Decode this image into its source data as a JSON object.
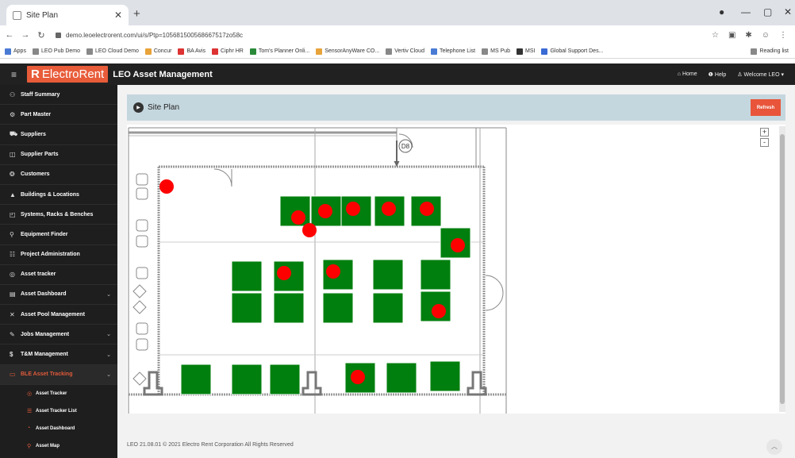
{
  "browser": {
    "tab_title": "Site Plan",
    "url": "demo.leoelectrorent.com/ui/s/Ptp=105681500568667517zo58c",
    "bookmarks": [
      "Apps",
      "LEO Pub Demo",
      "LEO Cloud Demo",
      "Concur",
      "BA Avis",
      "Ciphr HR",
      "Tom's Planner Onli...",
      "SensorAnyWare CO...",
      "Vertiv Cloud",
      "Telephone List",
      "MS Pub",
      "MSI",
      "Global Support Des...",
      "Reading list"
    ]
  },
  "header": {
    "brand": "ElectroRent",
    "app_title": "LEO Asset Management",
    "home": "Home",
    "help": "Help",
    "welcome": "Welcome LEO"
  },
  "sidebar": {
    "items": [
      {
        "label": "Staff Summary",
        "icon": "staff-icon"
      },
      {
        "label": "Part Master",
        "icon": "part-icon"
      },
      {
        "label": "Suppliers",
        "icon": "truck-icon"
      },
      {
        "label": "Supplier Parts",
        "icon": "parts-icon"
      },
      {
        "label": "Customers",
        "icon": "customers-icon"
      },
      {
        "label": "Buildings & Locations",
        "icon": "building-icon"
      },
      {
        "label": "Systems, Racks & Benches",
        "icon": "rack-icon"
      },
      {
        "label": "Equipment Finder",
        "icon": "search-icon"
      },
      {
        "label": "Project Administration",
        "icon": "project-icon"
      },
      {
        "label": "Asset tracker",
        "icon": "tracker-icon"
      },
      {
        "label": "Asset Dashboard",
        "icon": "dashboard-icon"
      },
      {
        "label": "Asset Pool Management",
        "icon": "pool-icon"
      },
      {
        "label": "Jobs Management",
        "icon": "jobs-icon"
      },
      {
        "label": "T&M Management",
        "icon": "tm-icon"
      },
      {
        "label": "BLE Asset Tracking",
        "icon": "ble-icon"
      }
    ],
    "sub_items": [
      {
        "label": "Asset Tracker"
      },
      {
        "label": "Asset Tracker List"
      },
      {
        "label": "Asset Dashboard"
      },
      {
        "label": "Asset Map"
      }
    ]
  },
  "panel": {
    "title": "Site Plan",
    "refresh_label": "Refresh",
    "zoom_in": "+",
    "zoom_out": "-"
  },
  "floorplan": {
    "room_label": "D8",
    "desk_color": "#007f0e",
    "marker_color": "#ff0000",
    "desks": [
      {
        "row": "top-strip",
        "count": 6
      },
      {
        "row": "right-single",
        "count": 1
      },
      {
        "row": "middle-grid",
        "count": 10
      },
      {
        "row": "bottom-row",
        "count": 6
      }
    ],
    "asset_marker_count": 13
  },
  "footer": {
    "text": "LEO 21.08.01 © 2021 Electro Rent Corporation All Rights Reserved"
  }
}
